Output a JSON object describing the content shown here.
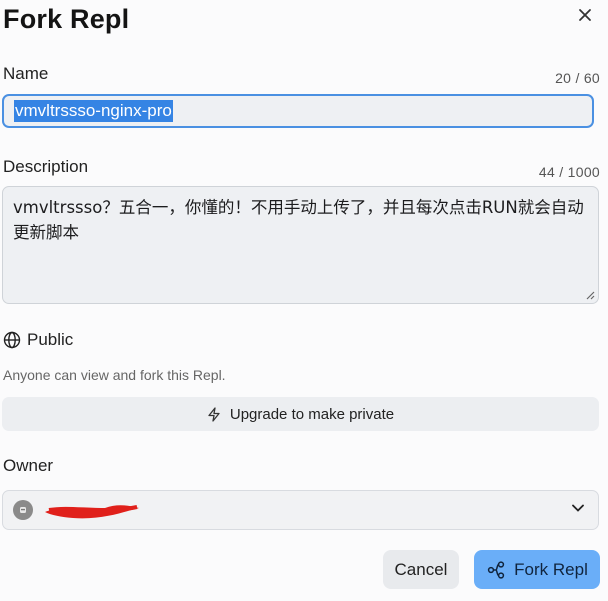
{
  "dialog": {
    "title": "Fork Repl"
  },
  "name": {
    "label": "Name",
    "counter": "20 / 60",
    "value": "vmvltrssso-nginx-pro"
  },
  "description": {
    "label": "Description",
    "counter": "44 / 1000",
    "value": "vmvltrssso？五合一，你懂的！不用手动上传了，并且每次点击RUN就会自动更新脚本"
  },
  "visibility": {
    "label": "Public",
    "helper": "Anyone can view and fork this Repl.",
    "upgrade_label": "Upgrade to make private",
    "icon": "globe-icon"
  },
  "owner": {
    "label": "Owner"
  },
  "actions": {
    "cancel_label": "Cancel",
    "fork_label": "Fork Repl"
  },
  "colors": {
    "accent": "#6aaef8",
    "focus_border": "#4a90e2",
    "selection": "#3584e4",
    "redaction": "#e0201b"
  }
}
